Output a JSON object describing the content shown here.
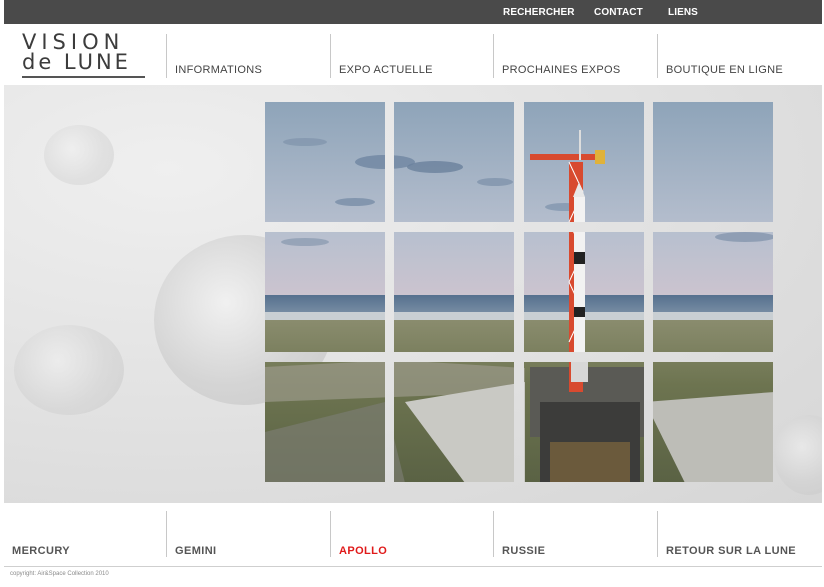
{
  "topbar": {
    "links": [
      {
        "label": "RECHERCHER"
      },
      {
        "label": "CONTACT"
      },
      {
        "label": "LIENS"
      }
    ]
  },
  "logo": {
    "line1": "VISION",
    "line2": "de LUNE"
  },
  "mainnav": {
    "items": [
      {
        "label": "INFORMATIONS"
      },
      {
        "label": "EXPO ACTUELLE"
      },
      {
        "label": "PROCHAINES EXPOS"
      },
      {
        "label": "BOUTIQUE EN LIGNE"
      }
    ]
  },
  "hero": {
    "image": "saturn-v-rocket-on-launch-pad",
    "grid": {
      "rows": 3,
      "columns": 4
    }
  },
  "bottomnav": {
    "items": [
      {
        "label": "MERCURY",
        "active": false
      },
      {
        "label": "GEMINI",
        "active": false
      },
      {
        "label": "APOLLO",
        "active": true
      },
      {
        "label": "RUSSIE",
        "active": false
      },
      {
        "label": "RETOUR SUR LA LUNE",
        "active": false
      }
    ]
  },
  "footer": {
    "copyright": "copyright: Air&Space Collection 2010"
  },
  "colors": {
    "topbar": "#4a4a4a",
    "active_nav": "#e01a1a",
    "nav_text": "#444444",
    "moon_gray": "#dddddd"
  }
}
